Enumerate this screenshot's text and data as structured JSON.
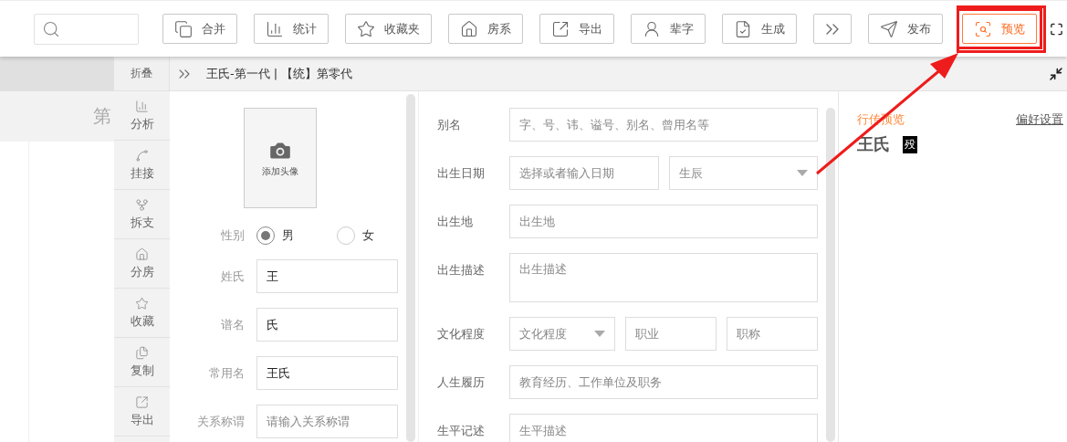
{
  "toolbar": [
    {
      "kind": "merge",
      "label": "合并",
      "selected": false
    },
    {
      "kind": "stats",
      "label": "统计",
      "selected": false
    },
    {
      "kind": "favorites",
      "label": "收藏夹",
      "selected": false
    },
    {
      "kind": "house",
      "label": "房系",
      "selected": false
    },
    {
      "kind": "export",
      "label": "导出",
      "selected": false
    },
    {
      "kind": "person",
      "label": "辈字",
      "selected": false
    },
    {
      "kind": "generate",
      "label": "生成",
      "selected": false
    },
    {
      "kind": "more",
      "selected": false
    },
    {
      "kind": "publish",
      "label": "发布",
      "selected": false
    },
    {
      "kind": "preview",
      "label": "预览",
      "selected": true
    }
  ],
  "panel": {
    "collapse_label": "折叠",
    "breadcrumb": "王氏-第一代 | 【统】第零代"
  },
  "background_list": {
    "heading": "第"
  },
  "tools": [
    {
      "kind": "analysis",
      "label": "分析"
    },
    {
      "kind": "link",
      "label": "挂接"
    },
    {
      "kind": "split",
      "label": "拆支"
    },
    {
      "kind": "house",
      "label": "分房"
    },
    {
      "kind": "favorite",
      "label": "收藏"
    },
    {
      "kind": "copy",
      "label": "复制"
    },
    {
      "kind": "export",
      "label": "导出"
    }
  ],
  "avatar": {
    "label": "添加头像"
  },
  "gender": {
    "label": "性别",
    "options": [
      {
        "label": "男",
        "selected": true
      },
      {
        "label": "女",
        "selected": false
      }
    ]
  },
  "basic_fields": [
    {
      "label": "姓氏",
      "value": "王"
    },
    {
      "label": "谱名",
      "value": "氏"
    },
    {
      "label": "常用名",
      "value": "王氏"
    },
    {
      "label": "关系称谓",
      "placeholder": "请输入关系称谓"
    }
  ],
  "detail_fields": [
    {
      "label": "别名",
      "inputs": [
        {
          "kind": "text",
          "placeholder": "字、号、讳、谥号、别名、曾用名等"
        }
      ]
    },
    {
      "label": "出生日期",
      "inputs": [
        {
          "kind": "text",
          "placeholder": "选择或者输入日期"
        },
        {
          "kind": "select",
          "placeholder": "生辰"
        }
      ]
    },
    {
      "label": "出生地",
      "inputs": [
        {
          "kind": "text",
          "placeholder": "出生地"
        }
      ]
    },
    {
      "label": "出生描述",
      "inputs": [
        {
          "kind": "textarea",
          "placeholder": "出生描述"
        }
      ]
    },
    {
      "label": "文化程度",
      "inputs": [
        {
          "kind": "select",
          "placeholder": "文化程度"
        },
        {
          "kind": "text",
          "placeholder": "职业"
        },
        {
          "kind": "text",
          "placeholder": "职称"
        }
      ]
    },
    {
      "label": "人生履历",
      "inputs": [
        {
          "kind": "text",
          "placeholder": "教育经历、工作单位及职务"
        }
      ]
    },
    {
      "label": "生平记述",
      "inputs": [
        {
          "kind": "text",
          "placeholder": "生平描述"
        }
      ]
    }
  ],
  "preview": {
    "title": "行传预览",
    "settings_link": "偏好设置",
    "name": "王氏",
    "status_badge": "殁"
  }
}
